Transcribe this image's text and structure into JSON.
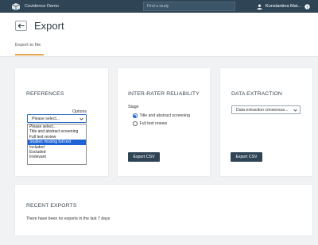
{
  "topbar": {
    "brand": "Covidence Demo",
    "search_placeholder": "Find a study",
    "user_name": "Konstantina Mat..."
  },
  "header": {
    "title": "Export",
    "tab": "Export to file"
  },
  "references": {
    "title": "REFERENCES",
    "options_label": "Options",
    "select_value": "Please select...",
    "options": [
      "Please select...",
      "Title and abstract screening",
      "Full text review",
      "Studies missing full text",
      "Included",
      "Excluded",
      "Irrelevant"
    ],
    "highlighted_option": "Studies missing full text"
  },
  "irr": {
    "title": "INTER-RATER RELIABILITY",
    "stage_label": "Stage",
    "radio_1": "Title and abstract screening",
    "radio_2": "Full text review",
    "export_button": "Export CSV"
  },
  "data_extraction": {
    "title": "DATA EXTRACTION",
    "select_value": "Data extraction consensus...",
    "export_button": "Export CSV"
  },
  "recent": {
    "title": "RECENT EXPORTS",
    "empty_message": "There have been no exports in the last 7 days"
  },
  "colors": {
    "topbar": "#2f4556",
    "accent_underline": "#e5a64d",
    "selection": "#1e63d3"
  }
}
